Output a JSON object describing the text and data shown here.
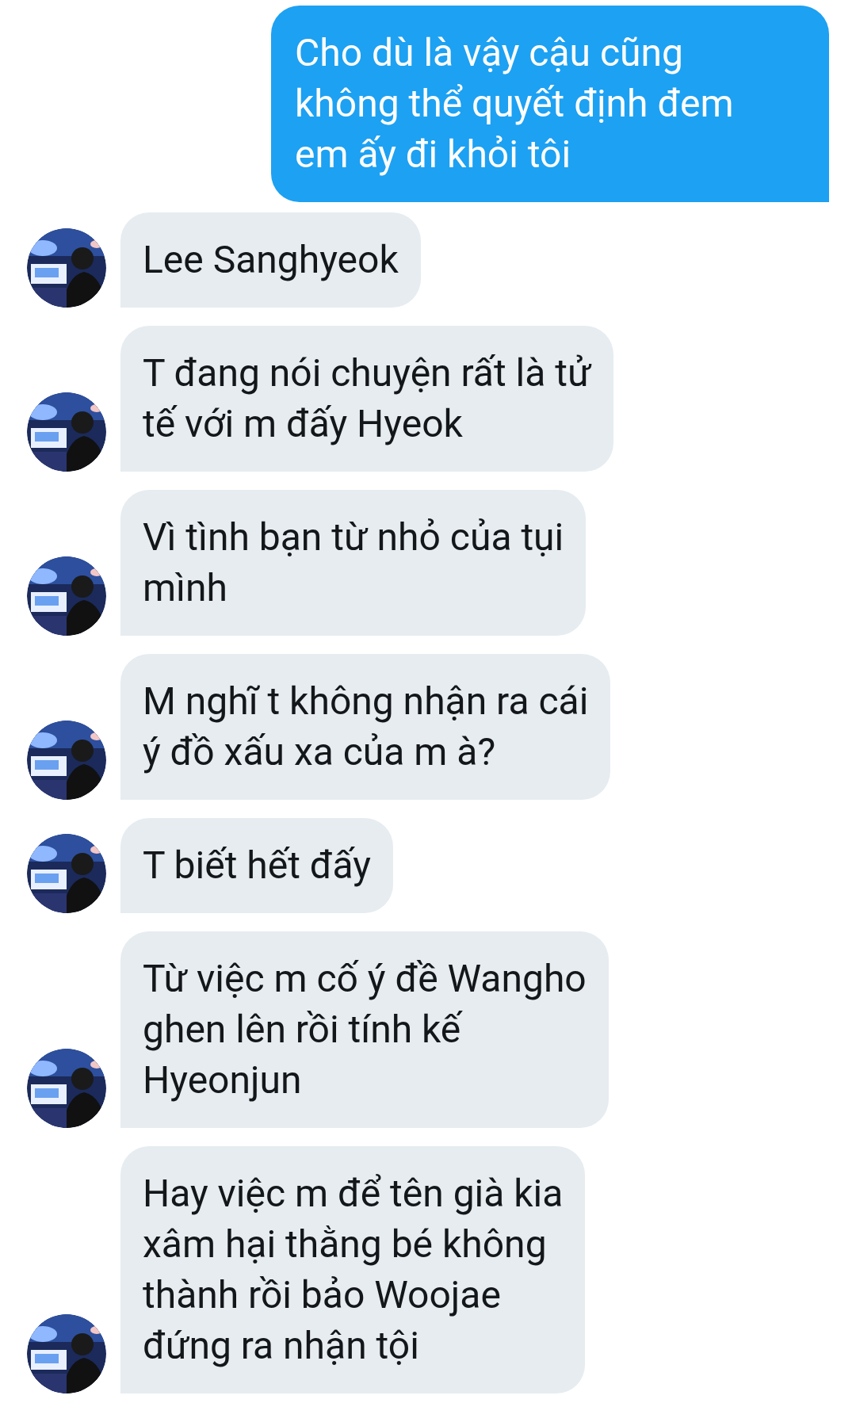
{
  "messages": [
    {
      "kind": "outgoing",
      "text": "Cho dù là vậy cậu cũng\nkhông thể quyết định đem\nem ấy đi khỏi tôi"
    },
    {
      "kind": "incoming",
      "text": "Lee Sanghyeok"
    },
    {
      "kind": "incoming",
      "text": "T đang nói chuyện rất là tử\ntế với m đấy Hyeok"
    },
    {
      "kind": "incoming",
      "text": "Vì tình bạn từ nhỏ của tụi\nmình"
    },
    {
      "kind": "incoming",
      "text": "M nghĩ t không nhận ra cái\ný đồ xấu xa của m à?"
    },
    {
      "kind": "incoming",
      "text": "T biết hết đấy"
    },
    {
      "kind": "incoming",
      "text": "Từ việc m cố ý đề Wangho\nghen lên rồi tính kế\nHyeonjun"
    },
    {
      "kind": "incoming",
      "text": "Hay việc m để tên già kia\nxâm hại thằng bé không\nthành rồi bảo Woojae\nđứng ra nhận tội"
    }
  ]
}
